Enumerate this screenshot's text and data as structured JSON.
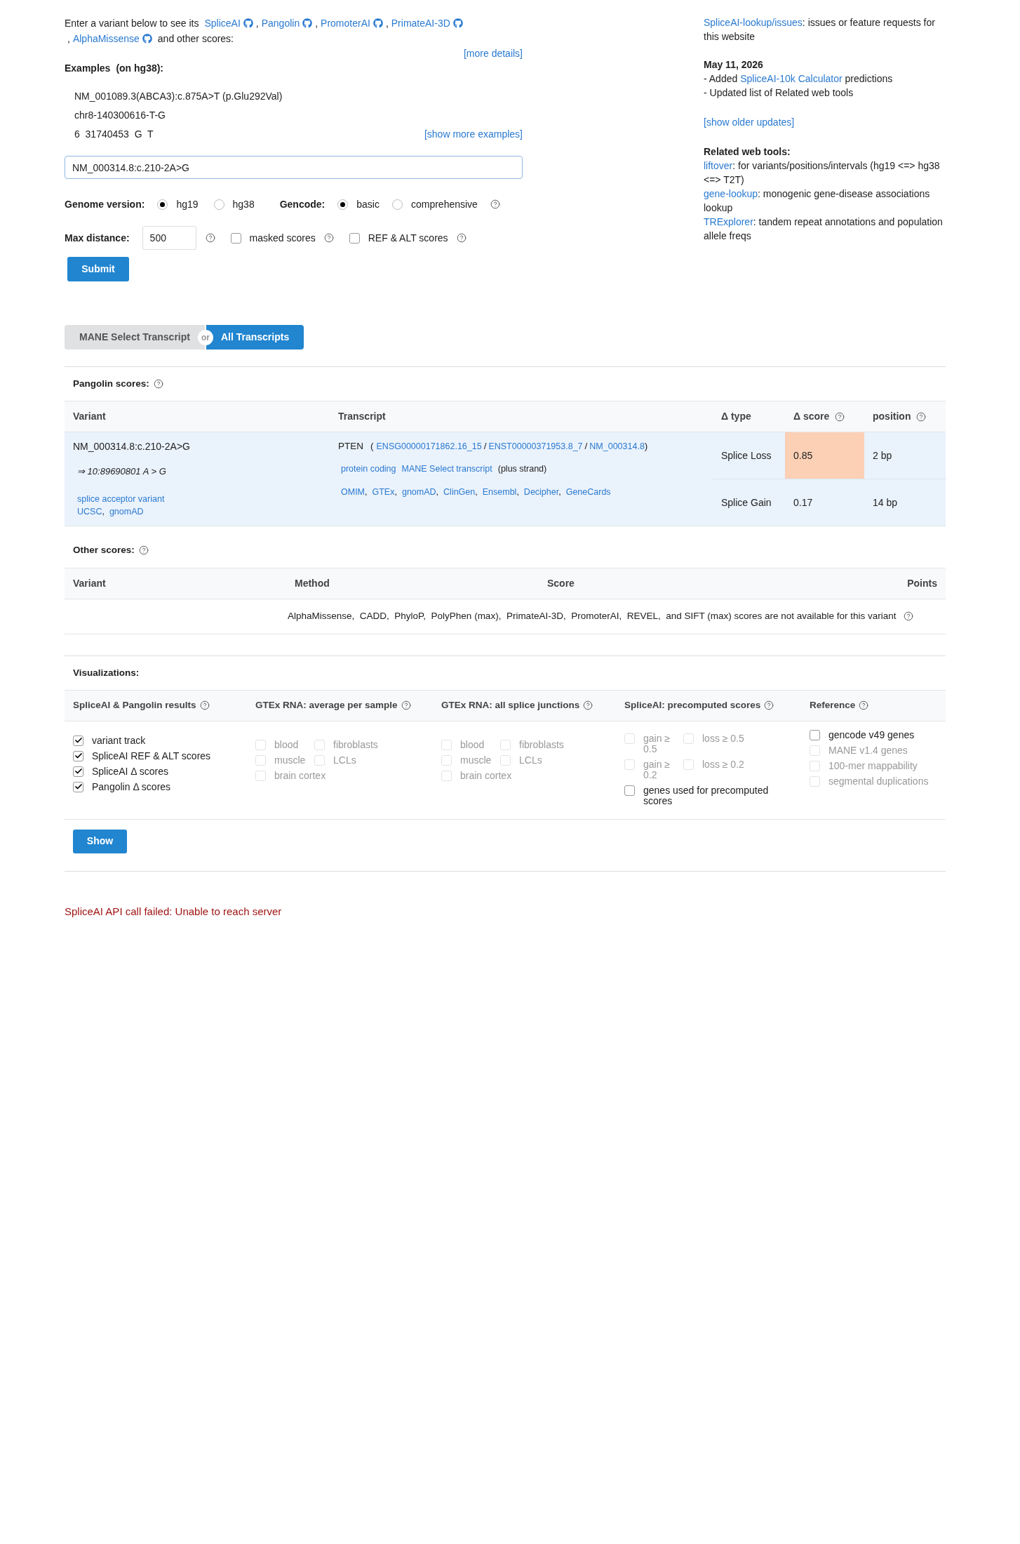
{
  "intro": {
    "lead": "Enter a variant below to see its",
    "tools": [
      {
        "name": "SpliceAI",
        "sep": ","
      },
      {
        "name": "Pangolin",
        "sep": ","
      },
      {
        "name": "PromoterAI",
        "sep": ","
      },
      {
        "name": "PrimateAI-3D",
        "sep": ","
      },
      {
        "name": "AlphaMissense"
      }
    ],
    "tail": "and other scores:"
  },
  "more_details": "[more details]",
  "examples": {
    "title": "Examples",
    "note": "(on hg38):",
    "items": [
      "NM_001089.3(ABCA3):c.875A>T (p.Glu292Val)",
      "chr8-140300616-T-G",
      "6  31740453  G  T"
    ],
    "more": "[show more examples]"
  },
  "variant_input": {
    "value": "NM_000314.8:c.210-2A>G"
  },
  "genome_version": {
    "label": "Genome version:",
    "options": [
      {
        "label": "hg19",
        "selected": true
      },
      {
        "label": "hg38",
        "selected": false
      }
    ]
  },
  "gencode": {
    "label": "Gencode:",
    "options": [
      {
        "label": "basic",
        "selected": true
      },
      {
        "label": "comprehensive",
        "selected": false
      }
    ]
  },
  "max_distance": {
    "label": "Max distance:",
    "value": "500"
  },
  "score_options": [
    {
      "label": "masked scores",
      "checked": false
    },
    {
      "label": "REF & ALT scores",
      "checked": false
    }
  ],
  "submit": "Submit",
  "sidebar": {
    "issues": {
      "link": "SpliceAI-lookup/issues",
      "text": ": issues or feature requests for this website"
    },
    "update": {
      "date": "May 11, 2026",
      "lines": [
        {
          "prefix": "- Added",
          "link": "SpliceAI-10k Calculator",
          "suffix": "predictions"
        },
        {
          "prefix": "- Updated list of Related web tools"
        }
      ]
    },
    "older": "[show older updates]",
    "related": {
      "title": "Related web tools:",
      "items": [
        {
          "link": "liftover",
          "text": ": for variants/positions/intervals (hg19 <=> hg38 <=> T2T)"
        },
        {
          "link": "gene-lookup",
          "text": ": monogenic gene-disease associations lookup"
        },
        {
          "link": "TRExplorer",
          "text": ": tandem repeat annotations and population allele freqs"
        }
      ]
    }
  },
  "transcript_toggle": [
    {
      "label": "MANE Select Transcript",
      "selected": false
    },
    {
      "label": "All Transcripts",
      "selected": true
    }
  ],
  "toggle_or": "or",
  "pangolin": {
    "title": "Pangolin scores:",
    "columns": [
      "Variant",
      "Transcript",
      "Δ type",
      "Δ score",
      "position"
    ],
    "variant": {
      "name": "NM_000314.8:c.210-2A>G",
      "coords": "⇒ 10:89690801 A > G",
      "consequence": "splice acceptor variant",
      "links": [
        {
          "label": "UCSC",
          "sep": ","
        },
        {
          "label": "gnomAD"
        }
      ]
    },
    "transcript": {
      "gene": "PTEN",
      "open": "(",
      "ids": [
        {
          "label": "ENSG00000171862.16_15",
          "sep": "/"
        },
        {
          "label": "ENST00000371953.8_7",
          "sep": "/"
        },
        {
          "label": "NM_000314.8"
        }
      ],
      "close": ")",
      "tags": [
        "protein coding",
        "MANE Select transcript"
      ],
      "strand": "(plus strand)",
      "links": [
        {
          "label": "OMIM",
          "sep": ","
        },
        {
          "label": "GTEx",
          "sep": ","
        },
        {
          "label": "gnomAD",
          "sep": ","
        },
        {
          "label": "ClinGen",
          "sep": ","
        },
        {
          "label": "Ensembl",
          "sep": ","
        },
        {
          "label": "Decipher",
          "sep": ","
        },
        {
          "label": "GeneCards"
        }
      ]
    },
    "scores": [
      {
        "type": "Splice Loss",
        "score": "0.85",
        "position": "2 bp",
        "color": "#fbd0b5"
      },
      {
        "type": "Splice Gain",
        "score": "0.17",
        "position": "14 bp"
      }
    ]
  },
  "other_scores": {
    "title": "Other scores:",
    "columns": [
      "Variant",
      "Method",
      "Score",
      "Points"
    ],
    "message": "AlphaMissense,  CADD,  PhyloP,  PolyPhen (max),  PrimateAI-3D,  PromoterAI,  REVEL,  and SIFT (max) scores are not available for this variant"
  },
  "visualizations": {
    "title": "Visualizations:",
    "columns": [
      {
        "title": "SpliceAI & Pangolin results",
        "rows": [
          [
            {
              "label": "variant track",
              "checked": true,
              "disabled": false
            }
          ],
          [
            {
              "label": "SpliceAI REF & ALT scores",
              "checked": true,
              "disabled": false
            }
          ],
          [
            {
              "label": "SpliceAI Δ scores",
              "checked": true,
              "disabled": false
            }
          ],
          [
            {
              "label": "Pangolin Δ scores",
              "checked": true,
              "disabled": false
            }
          ]
        ]
      },
      {
        "title": "GTEx RNA: average per sample",
        "rows": [
          [
            {
              "label": "blood",
              "checked": false,
              "disabled": true
            },
            {
              "label": "fibroblasts",
              "checked": false,
              "disabled": true
            }
          ],
          [
            {
              "label": "muscle",
              "checked": false,
              "disabled": true
            },
            {
              "label": "LCLs",
              "checked": false,
              "disabled": true
            }
          ],
          [
            {
              "label": "brain cortex",
              "checked": false,
              "disabled": true
            }
          ]
        ]
      },
      {
        "title": "GTEx RNA: all splice junctions",
        "rows": [
          [
            {
              "label": "blood",
              "checked": false,
              "disabled": true
            },
            {
              "label": "fibroblasts",
              "checked": false,
              "disabled": true
            }
          ],
          [
            {
              "label": "muscle",
              "checked": false,
              "disabled": true
            },
            {
              "label": "LCLs",
              "checked": false,
              "disabled": true
            }
          ],
          [
            {
              "label": "brain cortex",
              "checked": false,
              "disabled": true
            }
          ]
        ]
      },
      {
        "title": "SpliceAI: precomputed scores",
        "rows": [
          [
            {
              "label": "gain ≥ 0.5",
              "checked": false,
              "disabled": true
            },
            {
              "label": "loss ≥ 0.5",
              "checked": false,
              "disabled": true
            }
          ],
          [
            {
              "label": "gain ≥ 0.2",
              "checked": false,
              "disabled": true
            },
            {
              "label": "loss ≥ 0.2",
              "checked": false,
              "disabled": true
            }
          ],
          [
            {
              "label": "genes used for precomputed scores",
              "checked": false,
              "disabled": false
            }
          ]
        ]
      },
      {
        "title": "Reference",
        "rows": [
          [
            {
              "label": "gencode v49 genes",
              "checked": false,
              "disabled": false
            }
          ],
          [
            {
              "label": "MANE v1.4 genes",
              "checked": false,
              "disabled": true
            }
          ],
          [
            {
              "label": "100-mer mappability",
              "checked": false,
              "disabled": true
            }
          ],
          [
            {
              "label": "segmental duplications",
              "checked": false,
              "disabled": true
            }
          ]
        ]
      }
    ],
    "show": "Show"
  },
  "error": "SpliceAI API call failed: Unable to reach server"
}
